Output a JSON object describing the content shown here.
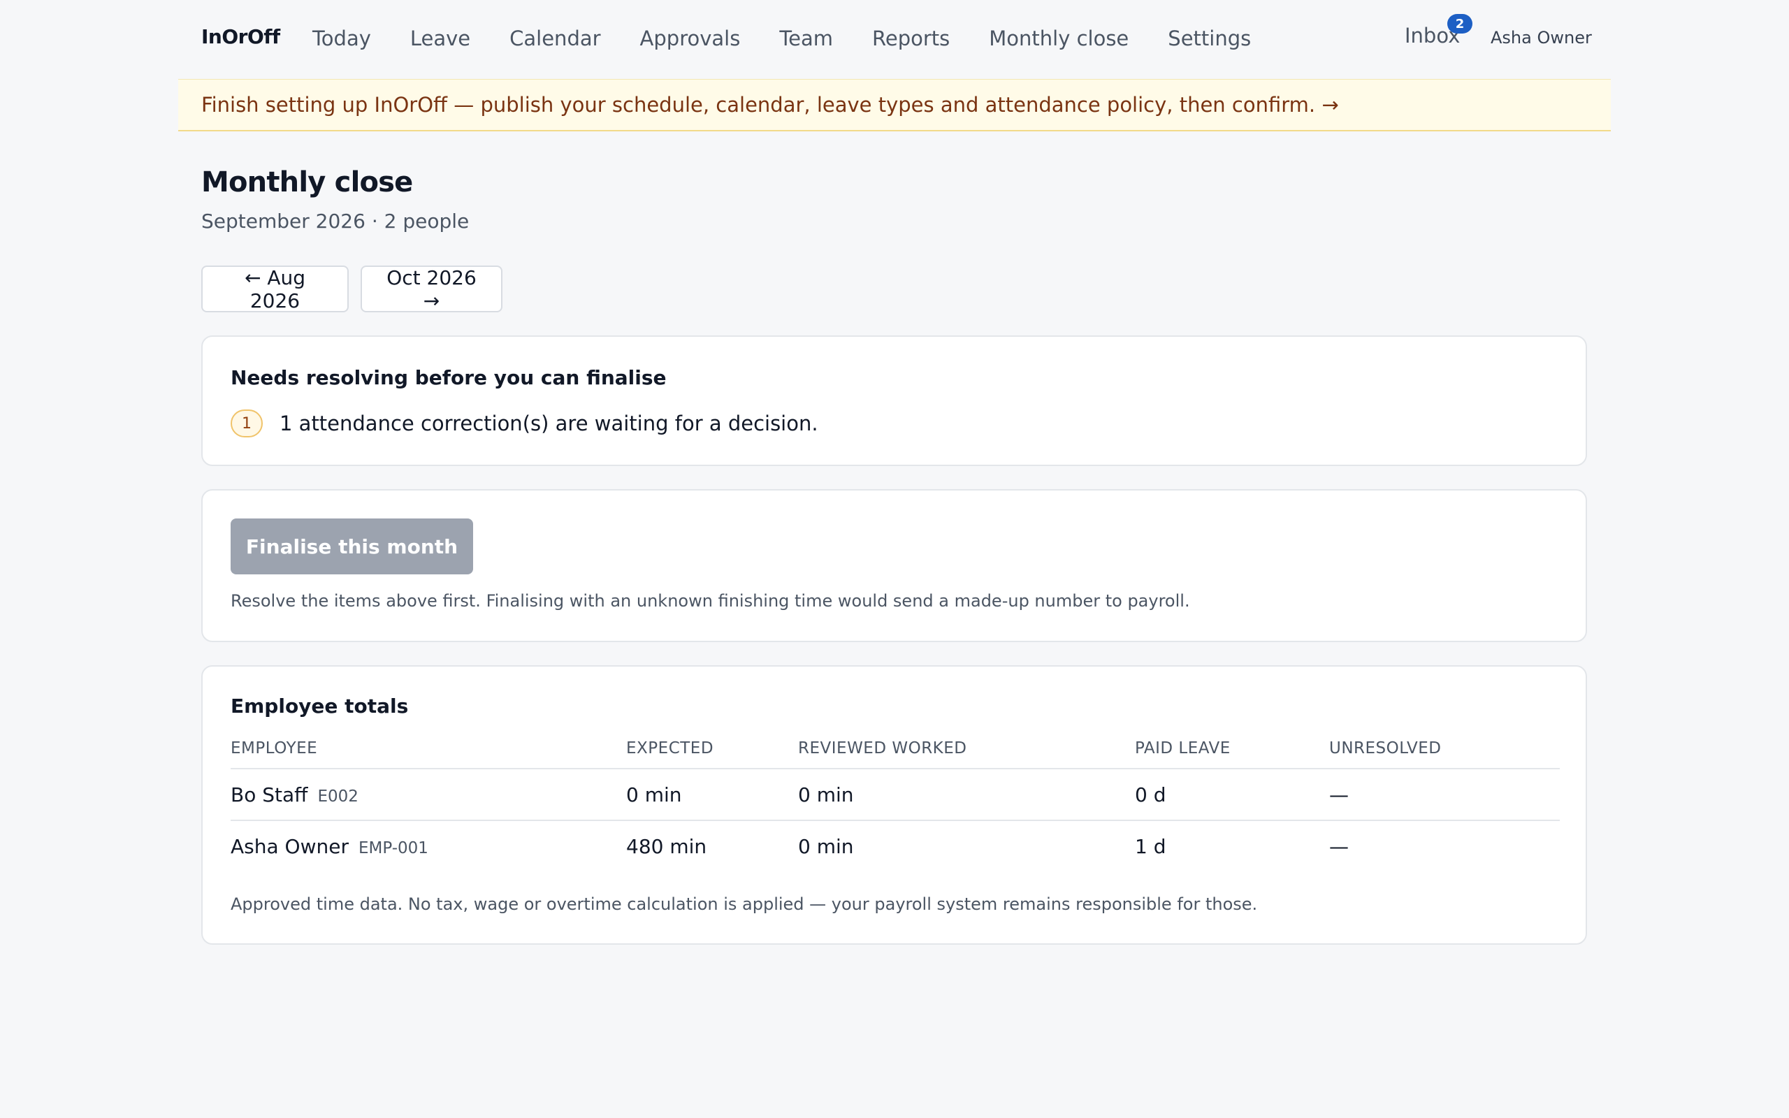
{
  "app": {
    "brand": "InOrOff"
  },
  "nav": {
    "items": [
      {
        "label": "Today"
      },
      {
        "label": "Leave"
      },
      {
        "label": "Calendar"
      },
      {
        "label": "Approvals"
      },
      {
        "label": "Team"
      },
      {
        "label": "Reports"
      },
      {
        "label": "Monthly close"
      },
      {
        "label": "Settings"
      }
    ],
    "inbox_label": "Inbox",
    "inbox_count": "2",
    "user_name": "Asha Owner"
  },
  "banner": {
    "text": "Finish setting up InOrOff — publish your schedule, calendar, leave types and attendance policy, then confirm. →"
  },
  "page": {
    "title": "Monthly close",
    "subtitle": "September 2026 · 2 people",
    "prev_month": "← Aug 2026",
    "next_month": "Oct 2026 →"
  },
  "issues": {
    "title": "Needs resolving before you can finalise",
    "items": [
      {
        "count": "1",
        "text": "1 attendance correction(s) are waiting for a decision."
      }
    ]
  },
  "finalise": {
    "button_label": "Finalise this month",
    "note": "Resolve the items above first. Finalising with an unknown finishing time would send a made-up number to payroll."
  },
  "totals": {
    "title": "Employee totals",
    "columns": [
      "EMPLOYEE",
      "EXPECTED",
      "REVIEWED WORKED",
      "PAID LEAVE",
      "UNRESOLVED"
    ],
    "rows": [
      {
        "name": "Bo Staff",
        "id": "E002",
        "expected": "0 min",
        "worked": "0 min",
        "paid_leave": "0 d",
        "unresolved": "—"
      },
      {
        "name": "Asha Owner",
        "id": "EMP-001",
        "expected": "480 min",
        "worked": "0 min",
        "paid_leave": "1 d",
        "unresolved": "—"
      }
    ],
    "footnote": "Approved time data. No tax, wage or overtime calculation is applied — your payroll system remains responsible for those."
  }
}
